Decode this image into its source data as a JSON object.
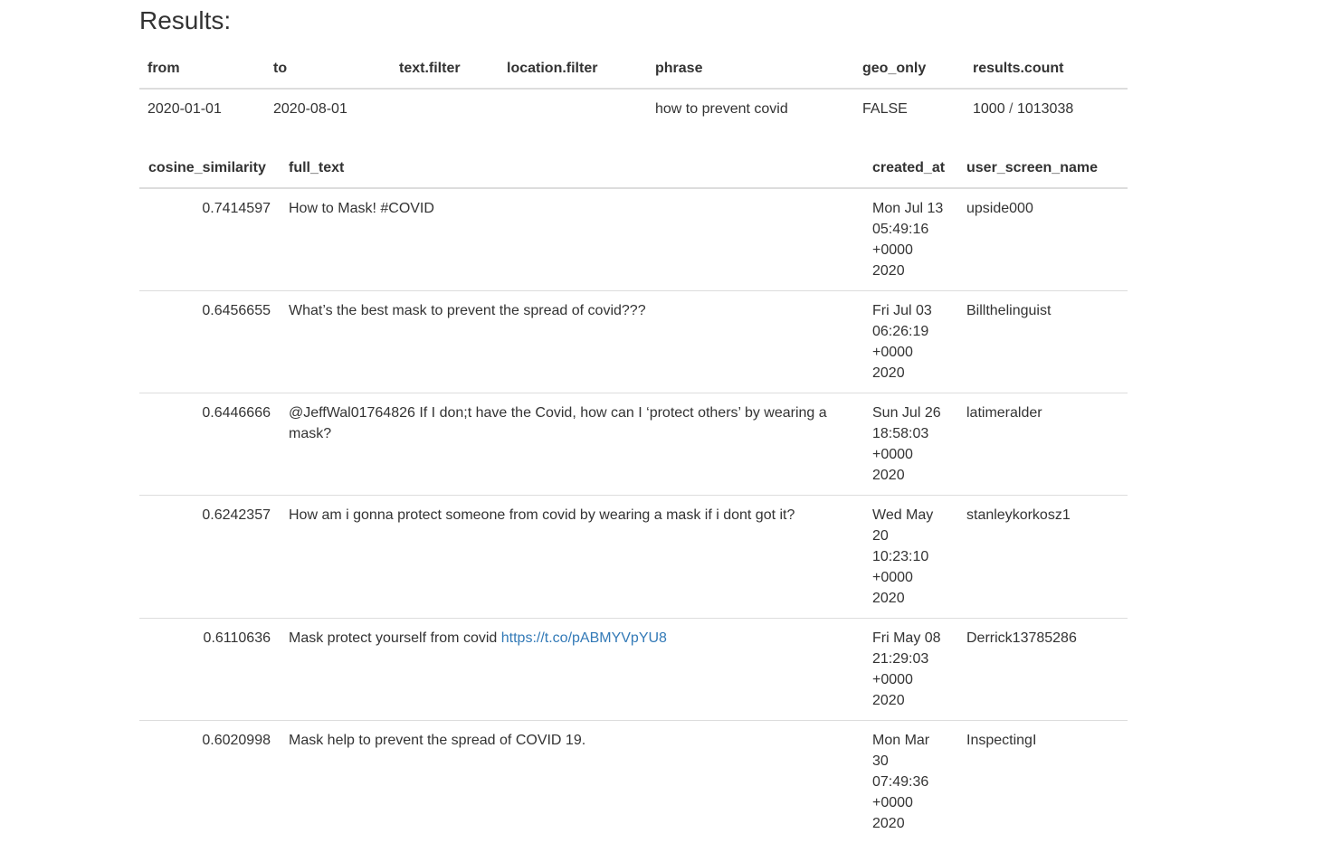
{
  "heading": "Results:",
  "query": {
    "headers": [
      "from",
      "to",
      "text.filter",
      "location.filter",
      "phrase",
      "geo_only",
      "results.count"
    ],
    "row": {
      "from": "2020-01-01",
      "to": "2020-08-01",
      "text_filter": "",
      "location_filter": "",
      "phrase": "how to prevent covid",
      "geo_only": "FALSE",
      "results_shown": "1000",
      "results_sep": "/",
      "results_total": "1013038"
    }
  },
  "results": {
    "headers": [
      "cosine_similarity",
      "full_text",
      "created_at",
      "user_screen_name"
    ],
    "rows": [
      {
        "score": "0.7414597",
        "text": "How to Mask! #COVID",
        "link": "",
        "created": [
          "Mon Jul 13",
          "05:49:16",
          "+0000",
          "2020"
        ],
        "user": "upside000"
      },
      {
        "score": "0.6456655",
        "text": "What’s the best mask to prevent the spread of covid???",
        "link": "",
        "created": [
          "Fri Jul 03",
          "06:26:19",
          "+0000",
          "2020"
        ],
        "user": "Billthelinguist"
      },
      {
        "score": "0.6446666",
        "text": "@JeffWal01764826 If I don;t have the Covid, how can I ‘protect others’ by wearing a mask?",
        "link": "",
        "created": [
          "Sun Jul 26",
          "18:58:03",
          "+0000",
          "2020"
        ],
        "user": "latimeralder"
      },
      {
        "score": "0.6242357",
        "text": "How am i gonna protect someone from covid by wearing a mask if i dont got it?",
        "link": "",
        "created": [
          "Wed May",
          "20",
          "10:23:10",
          "+0000",
          "2020"
        ],
        "user": "stanleykorkosz1"
      },
      {
        "score": "0.6110636",
        "text": "Mask protect yourself from covid ",
        "link": "https://t.co/pABMYVpYU8",
        "created": [
          "Fri May 08",
          "21:29:03",
          "+0000",
          "2020"
        ],
        "user": "Derrick13785286"
      },
      {
        "score": "0.6020998",
        "text": "Mask help to prevent the spread of COVID 19.",
        "link": "",
        "created": [
          "Mon Mar",
          "30",
          "07:49:36",
          "+0000",
          "2020"
        ],
        "user": "InspectingI"
      }
    ]
  }
}
